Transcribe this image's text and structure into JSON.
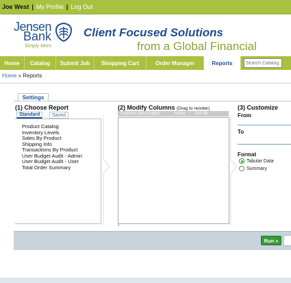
{
  "topbar": {
    "user": "Joe West",
    "my_profile": "My Profile",
    "logout": "Log Out"
  },
  "brand": {
    "name_line1": "Jensen",
    "name_line2": "Bank",
    "slogan": "Simply More.",
    "tagline1": "Client Focused Solutions",
    "tagline2": "from a Global Financial"
  },
  "nav": {
    "items": [
      {
        "label": "Home"
      },
      {
        "label": "Catalog"
      },
      {
        "label": "Submit Job"
      },
      {
        "label": "Shopping Cart"
      },
      {
        "label": "Order Manager"
      },
      {
        "label": "Reports"
      }
    ],
    "active": "Reports",
    "search_placeholder": "Search Catalog..."
  },
  "breadcrumb": {
    "home": "Home",
    "sep": " » ",
    "current": "Reports"
  },
  "settings_tab": "Settings",
  "choose_report": {
    "title": "(1) Choose Report",
    "tabs": [
      "Standard",
      "Saved"
    ],
    "active_tab": "Standard",
    "reports": [
      "Product Catalog",
      "Inventory Levels",
      "Sales By Product",
      "Shipping Info",
      "Transactions By Product",
      "User Budget Audit - Admin",
      "User Budget Audit - User",
      "Total Order Summary"
    ]
  },
  "modify_columns": {
    "title": "(2) Modify Columns",
    "hint": "(Drag to reorder)",
    "headers": [
      "Columns (left to right)",
      "Active",
      "Sort By"
    ],
    "footnote": "*"
  },
  "customize": {
    "title": "(3) Customize",
    "from_label": "From",
    "to_label": "To",
    "format_label": "Format",
    "options": [
      {
        "label": "Tabular Data",
        "checked": true
      },
      {
        "label": "Summary",
        "checked": false
      }
    ]
  },
  "run_button": "Run »",
  "colors": {
    "accent_green": "#a9c13f",
    "brand_blue": "#1f4e8f",
    "run_green": "#3a9a3a"
  }
}
